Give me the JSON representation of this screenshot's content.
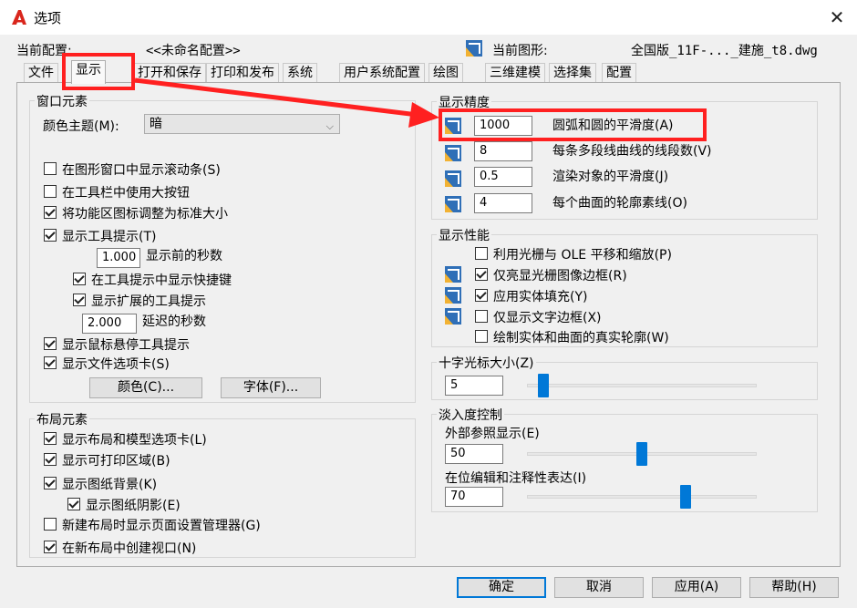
{
  "window": {
    "title": "选项",
    "close_glyph": "✕"
  },
  "header": {
    "profile_label": "当前配置:",
    "profile_value": "<<未命名配置>>",
    "drawing_label": "当前图形:",
    "drawing_value": "全国版_11F-..._建施_t8.dwg"
  },
  "tabs": [
    "文件",
    "显示",
    "打开和保存",
    "打印和发布",
    "系统",
    "用户系统配置",
    "绘图",
    "三维建模",
    "选择集",
    "配置"
  ],
  "window_elements": {
    "title": "窗口元素",
    "color_theme_label": "颜色主题(M):",
    "color_theme_value": "暗",
    "show_scrollbars": "在图形窗口中显示滚动条(S)",
    "large_buttons": "在工具栏中使用大按钮",
    "resize_ribbon_icons": "将功能区图标调整为标准大小",
    "show_tooltips": "显示工具提示(T)",
    "tooltip_delay_value": "1.000",
    "tooltip_delay_label": "显示前的秒数",
    "show_shortcut_keys": "在工具提示中显示快捷键",
    "show_extended_tooltips": "显示扩展的工具提示",
    "extended_delay_value": "2.000",
    "extended_delay_label": "延迟的秒数",
    "show_rollover_tooltips": "显示鼠标悬停工具提示",
    "show_file_tabs": "显示文件选项卡(S)",
    "colors_button": "颜色(C)...",
    "fonts_button": "字体(F)..."
  },
  "layout_elements": {
    "title": "布局元素",
    "show_layout_tabs": "显示布局和模型选项卡(L)",
    "show_printable_area": "显示可打印区域(B)",
    "show_paper_background": "显示图纸背景(K)",
    "show_paper_shadow": "显示图纸阴影(E)",
    "show_page_setup_manager": "新建布局时显示页面设置管理器(G)",
    "create_viewport": "在新布局中创建视口(N)"
  },
  "display_resolution": {
    "title": "显示精度",
    "rows": [
      {
        "value": "1000",
        "label": "圆弧和圆的平滑度(A)"
      },
      {
        "value": "8",
        "label": "每条多段线曲线的线段数(V)"
      },
      {
        "value": "0.5",
        "label": "渲染对象的平滑度(J)"
      },
      {
        "value": "4",
        "label": "每个曲面的轮廓素线(O)"
      }
    ]
  },
  "display_performance": {
    "title": "显示性能",
    "raster_ole": "利用光栅与 OLE 平移和缩放(P)",
    "highlight_raster": "仅亮显光栅图像边框(R)",
    "true_color_fill": "应用实体填充(Y)",
    "text_frame": "仅显示文字边框(X)",
    "true_silhouettes": "绘制实体和曲面的真实轮廓(W)"
  },
  "crosshair": {
    "title": "十字光标大小(Z)",
    "value": "5",
    "level_percent": 5
  },
  "fade_control": {
    "title": "淡入度控制",
    "xref_label": "外部参照显示(E)",
    "xref_value": "50",
    "xref_level_percent": 50,
    "inplace_label": "在位编辑和注释性表达(I)",
    "inplace_value": "70",
    "inplace_level_percent": 70
  },
  "footer": {
    "ok": "确定",
    "cancel": "取消",
    "apply": "应用(A)",
    "help": "帮助(H)"
  },
  "colors": {
    "annotation_red": "#ff2020",
    "accent_blue": "#0078d7"
  }
}
